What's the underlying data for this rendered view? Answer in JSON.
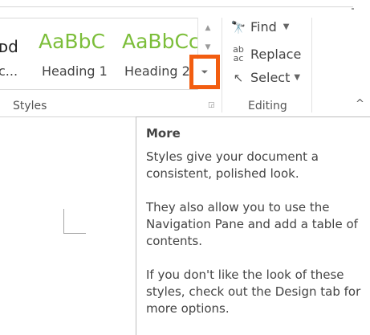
{
  "styles_gallery": {
    "items": [
      {
        "sample": "ᴅd",
        "label": "c..."
      },
      {
        "sample": "AaBbC",
        "label": "Heading 1"
      },
      {
        "sample": "AaBbCc",
        "label": "Heading 2"
      }
    ],
    "scroll_up_icon": "triangle-up-icon",
    "scroll_down_icon": "triangle-down-icon",
    "more_icon": "more-icon",
    "highlight_color": "#f25d10",
    "heading_color": "#7cbe3a"
  },
  "groups": {
    "styles_label": "Styles",
    "editing_label": "Editing"
  },
  "editing": {
    "find_label": "Find",
    "replace_label": "Replace",
    "select_label": "Select"
  },
  "tooltip": {
    "title": "More",
    "paragraphs": [
      "Styles give your document a\nconsistent, polished look.",
      "They also allow you to use the\nNavigation Pane and add a table of\ncontents.",
      "If you don't like the look of these\nstyles, check out the Design tab for\nmore options."
    ]
  }
}
